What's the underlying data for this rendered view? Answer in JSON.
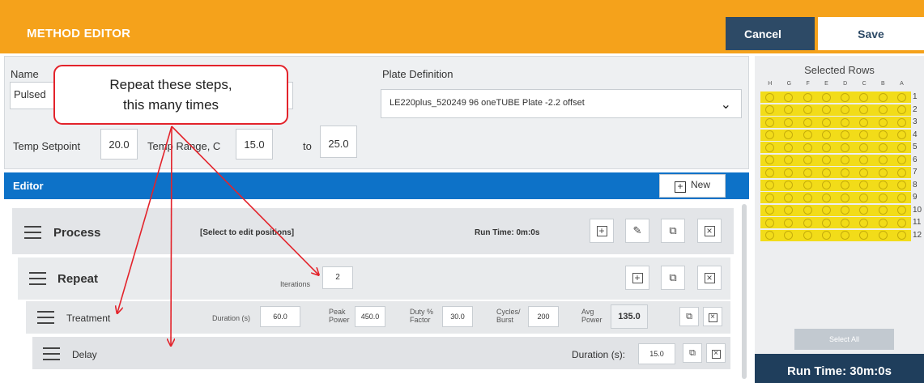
{
  "header": {
    "title": "METHOD EDITOR",
    "cancel_label": "Cancel",
    "save_label": "Save"
  },
  "settings": {
    "name_label": "Name",
    "name_value": "Pulsed",
    "plate_label": "Plate Definition",
    "plate_value": "LE220plus_520249 96 oneTUBE Plate -2.2 offset",
    "temp_setpoint_label": "Temp Setpoint",
    "temp_setpoint_value": "20.0",
    "temp_range_label": "Temp Range, C",
    "temp_range_min": "15.0",
    "temp_range_to": "to",
    "temp_range_max": "25.0"
  },
  "editor": {
    "title": "Editor",
    "new_label": "New",
    "process": {
      "label": "Process",
      "positions": "[Select to edit positions]",
      "run_time": "Run Time: 0m:0s"
    },
    "repeat": {
      "label": "Repeat",
      "iterations_label": "Iterations",
      "iterations_value": "2"
    },
    "treatment": {
      "label": "Treatment",
      "duration_label": "Duration (s)",
      "duration_value": "60.0",
      "peak_power_label_1": "Peak",
      "peak_power_label_2": "Power",
      "peak_power_value": "450.0",
      "duty_label_1": "Duty %",
      "duty_label_2": "Factor",
      "duty_value": "30.0",
      "cycles_label_1": "Cycles/",
      "cycles_label_2": "Burst",
      "cycles_value": "200",
      "avg_label_1": "Avg",
      "avg_label_2": "Power",
      "avg_value": "135.0"
    },
    "delay": {
      "label": "Delay",
      "duration_label": "Duration (s):",
      "duration_value": "15.0"
    }
  },
  "plate_panel": {
    "title": "Selected Rows",
    "columns": [
      "H",
      "G",
      "F",
      "E",
      "D",
      "C",
      "B",
      "A"
    ],
    "rows": [
      "1",
      "2",
      "3",
      "4",
      "5",
      "6",
      "7",
      "8",
      "9",
      "10",
      "11",
      "12"
    ],
    "select_all_label": "Select All",
    "run_time": "Run Time: 30m:0s",
    "well_color": "#f2dc19"
  },
  "callout": {
    "line1": "Repeat these steps,",
    "line2": "this many times"
  },
  "colors": {
    "header_orange": "#f5a21b",
    "navy": "#2d4a66",
    "editor_blue": "#0d72c8",
    "callout_red": "#e3232b"
  },
  "icons": {
    "add": "add-icon",
    "edit": "edit-icon",
    "copy": "copy-icon",
    "delete": "delete-icon",
    "drag": "drag-handle-icon",
    "dropdown": "chevron-down-icon"
  }
}
